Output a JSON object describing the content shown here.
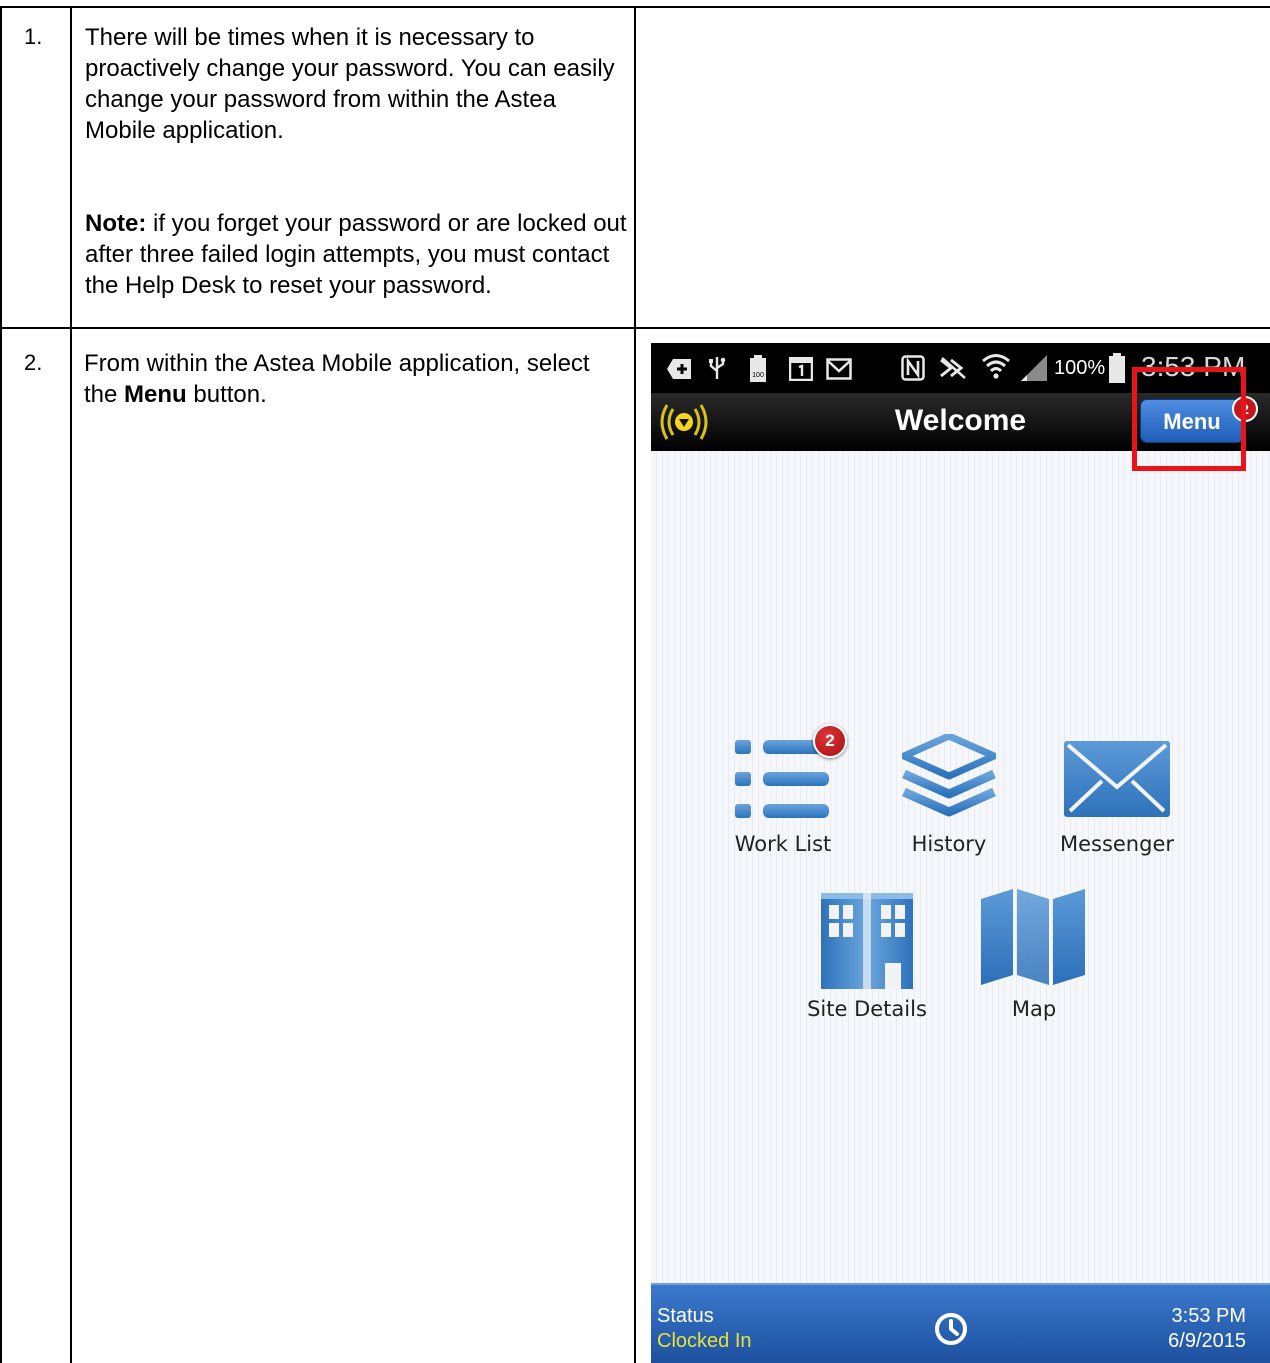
{
  "steps": [
    {
      "number": "1.",
      "paragraph_1": "There will be times when it is necessary to proactively change your password. You can easily change your password from within the Astea Mobile application.",
      "note_label": "Note:",
      "note_text": " if you forget your password or are locked out after three failed login attempts, you must contact the Help Desk to reset your password."
    },
    {
      "number": "2.",
      "text_before": "From within the Astea Mobile application, select the ",
      "bold": "Menu",
      "text_after": " button."
    }
  ],
  "phone": {
    "statusbar": {
      "battery_percent": "100%",
      "time": "3:53 PM",
      "icons": [
        "add-box-icon",
        "usb-icon",
        "battery-full-icon",
        "calendar-icon",
        "email-icon",
        "nfc-icon",
        "mute-icon",
        "wifi-icon",
        "signal-icon",
        "battery-icon"
      ]
    },
    "titlebar": {
      "title": "Welcome",
      "menu_label": "Menu",
      "menu_badge": "2",
      "logo_icon": "astea-logo-icon"
    },
    "tiles": [
      {
        "label": "Work List",
        "icon": "list-icon",
        "badge": "2"
      },
      {
        "label": "History",
        "icon": "layers-icon"
      },
      {
        "label": "Messenger",
        "icon": "envelope-icon"
      },
      {
        "label": "Site Details",
        "icon": "building-icon"
      },
      {
        "label": "Map",
        "icon": "map-icon"
      }
    ],
    "footer": {
      "status_label": "Status",
      "status_value": "Clocked In",
      "clock_icon": "clock-icon",
      "time": "3:53 PM",
      "date": "6/9/2015"
    }
  },
  "colors": {
    "highlight": "#e8141a",
    "accent_blue": "#2f6fc4",
    "status_yellow": "#e8e03a",
    "badge_red": "#c1161a"
  }
}
